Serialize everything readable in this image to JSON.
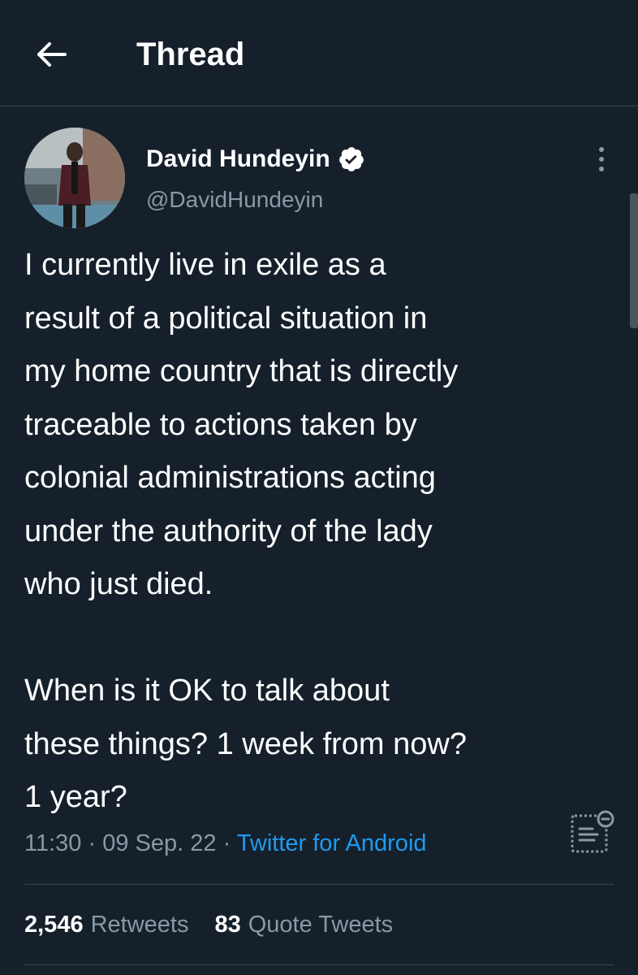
{
  "header": {
    "back_icon": "arrow-left-icon",
    "title": "Thread"
  },
  "tweet": {
    "author": {
      "name": "David Hundeyin",
      "handle": "@DavidHundeyin",
      "verified_icon": "verified-badge-icon"
    },
    "more_icon": "more-vertical-icon",
    "text_lines": [
      "I currently live in exile as a",
      "result of a political situation in",
      "my home country that is directly",
      "traceable to actions taken by",
      "colonial administrations acting",
      "under the authority of the lady",
      "who just died.",
      "",
      "When is it OK to talk about",
      "these things? 1 week from now?",
      "1 year?"
    ],
    "time": "11:30",
    "separator": "·",
    "date": "09 Sep. 22",
    "source": "Twitter for Android",
    "analytics_icon": "analytics-icon"
  },
  "stats": {
    "retweets_count": "2,546",
    "retweets_label": "Retweets",
    "quotes_count": "83",
    "quotes_label": "Quote Tweets"
  },
  "colors": {
    "background": "#15202b",
    "text_primary": "#ffffff",
    "text_secondary": "#8b98a5",
    "accent": "#1d9bf0",
    "divider": "#38444d"
  }
}
